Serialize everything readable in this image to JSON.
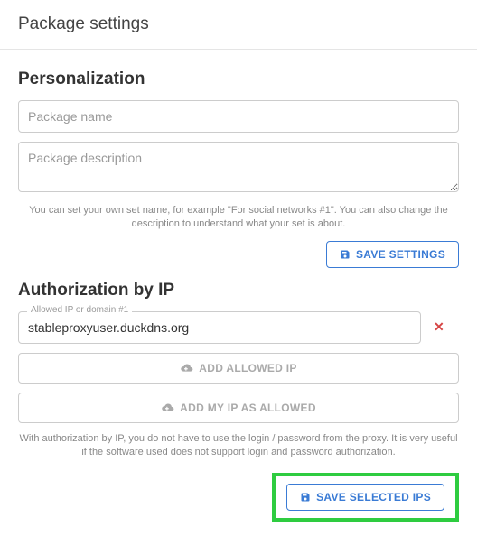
{
  "page": {
    "title": "Package settings"
  },
  "personalization": {
    "heading": "Personalization",
    "name_placeholder": "Package name",
    "name_value": "",
    "description_placeholder": "Package description",
    "description_value": "",
    "help": "You can set your own set name, for example \"For social networks #1\". You can also change the description to understand what your set is about.",
    "save_label": "SAVE SETTINGS"
  },
  "authorization": {
    "heading": "Authorization by IP",
    "ip_label": "Allowed IP or domain #1",
    "ip_value": "stableproxyuser.duckdns.org",
    "add_ip_label": "ADD ALLOWED IP",
    "add_my_ip_label": "ADD MY IP AS ALLOWED",
    "help": "With authorization by IP, you do not have to use the login / password from the proxy. It is very useful if the software used does not support login and password authorization.",
    "save_label": "SAVE SELECTED IPS"
  }
}
